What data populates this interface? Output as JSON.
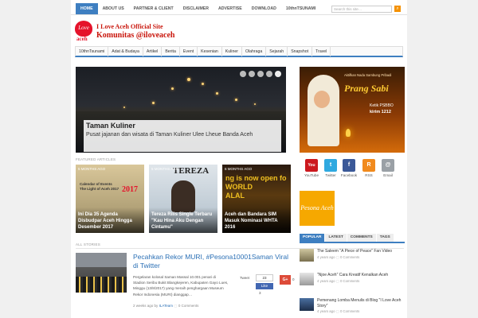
{
  "topnav": {
    "items": [
      "HOME",
      "ABOUT US",
      "PARTNER & CLIENT",
      "DISCLAIMER",
      "ADVERTISE",
      "DOWNLOAD",
      "10thnTSUNAMI"
    ],
    "search_placeholder": "Search this site…"
  },
  "logo": {
    "heart_text": "Love",
    "heart_sub": "aceh",
    "line1": "I Love Aceh Official Site",
    "line2": "Komunitas @iloveaceh"
  },
  "catnav": [
    "10thnTsunami",
    "Adat & Budaya",
    "Artikel",
    "Berita",
    "Event",
    "Kesenian",
    "Kuliner",
    "Olahraga",
    "Sejarah",
    "Snapshot",
    "Travel"
  ],
  "slider": {
    "title": "Taman Kuliner",
    "description": "Pusat jajanan dan wisata di Taman Kuliner Ulee Lheue Banda Aceh",
    "dots": 5,
    "active_dot": 5
  },
  "featured": {
    "heading": "FEATURED ARTICLES",
    "items": [
      {
        "ago": "5 MONTHS AGO",
        "title": "Ini Dia 35 Agenda Disbudpar Aceh Hingga Desember 2017",
        "color": "#b9a57a"
      },
      {
        "ago": "5 MONTHS AGO",
        "title": "Tereza Rilis Single Terbaru \"Kau Hina Aku Dengan Cintamu\"",
        "color": "#8fa7bc"
      },
      {
        "ago": "6 MONTHS AGO",
        "title": "Aceh dan Bandara SIM Masuk Nominasi WHTA 2016",
        "color": "#3a2a1a"
      }
    ],
    "img_text_1": "Calendar of Events\nThe Light of Aceh 2017",
    "img_text_2": "TEREZA",
    "img_text_3": "ng is now open fo\nWORLD\nALAL"
  },
  "stories": {
    "heading": "ALL STORIES",
    "title": "Pecahkan Rekor MURI, #Pesona10001Saman Viral di Twitter",
    "excerpt": "Pergelaran kolosal Saman Massal 10.001 penari di Stadion Seribu Bukit Blangkejeren, Kabupaten Gayo Lues, Minggu (13/8/2017) yang meraih penghargaan Museum Rekor Indonesia (MURI) dianggap…",
    "meta_time": "2 weeks ago",
    "meta_by": "by",
    "meta_author": "ILATeam",
    "meta_comments": "0 Comments",
    "tweet_label": "Tweet",
    "tweet_count": "23",
    "like_label": "Like",
    "like_count": "3",
    "gplus": "G+",
    "gplus_count": "0"
  },
  "right_ad": {
    "top_text": "Aktifkan Nada Sambung Pribadi",
    "title": "Prang Sabi",
    "kelik": "Ketik PSBBO",
    "kirim": "kirim 1212"
  },
  "social": [
    {
      "label": "YouTube",
      "icon": "You",
      "color": "#cc181e"
    },
    {
      "label": "Twitter",
      "icon": "t",
      "color": "#2fa9e0"
    },
    {
      "label": "Facebook",
      "icon": "f",
      "color": "#3b5998"
    },
    {
      "label": "RSS",
      "icon": "R",
      "color": "#f18a1d"
    },
    {
      "label": "Email",
      "icon": "@",
      "color": "#9aa0a6"
    }
  ],
  "badge": "Pesona Aceh",
  "tabs": [
    "POPULAR",
    "LATEST",
    "COMMENTS",
    "TAGS"
  ],
  "popular": [
    {
      "title": "The Saleem \"A Piece of Peace\" Fan Video",
      "time": "4 years ago",
      "comments": "0 Comments"
    },
    {
      "title": "\"Njoe Aceh\" Cara Kreatif Kenalkan Aceh",
      "time": "4 years ago",
      "comments": "0 Comments"
    },
    {
      "title": "Pemenang Lomba Menulis di Blog \"I Love Aceh Story\"",
      "time": "4 years ago",
      "comments": "0 Comments"
    }
  ]
}
